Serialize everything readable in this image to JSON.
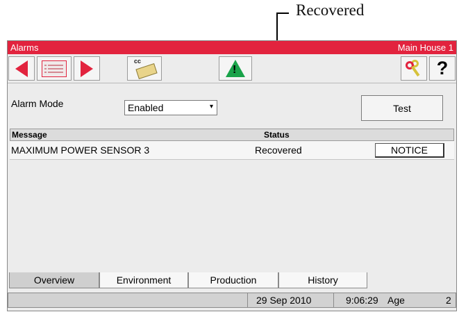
{
  "callout": {
    "label": "Recovered"
  },
  "window": {
    "title": "Alarms",
    "location": "Main House 1"
  },
  "toolbar": {
    "buttons": [
      {
        "name": "prev-arrow-icon"
      },
      {
        "name": "alarm-list-icon"
      },
      {
        "name": "next-arrow-icon"
      },
      {
        "name": "cc-copy-icon",
        "label": "cc"
      },
      {
        "name": "warning-icon",
        "label": "!"
      },
      {
        "name": "keys-icon"
      },
      {
        "name": "help-icon",
        "label": "?"
      }
    ],
    "colors": {
      "accent": "#e2233e",
      "warning": "#1aa34a"
    }
  },
  "alarm_mode": {
    "label": "Alarm Mode",
    "selected": "Enabled"
  },
  "test_button": {
    "label": "Test"
  },
  "table": {
    "headers": {
      "message": "Message",
      "status": "Status"
    },
    "rows": [
      {
        "message": "MAXIMUM POWER SENSOR  3",
        "status": "Recovered",
        "action": "NOTICE"
      }
    ]
  },
  "tabs": [
    {
      "label": "Overview",
      "active": true
    },
    {
      "label": "Environment",
      "active": false
    },
    {
      "label": "Production",
      "active": false
    },
    {
      "label": "History",
      "active": false
    }
  ],
  "status_bar": {
    "date": "29 Sep 2010",
    "time": "9:06:29",
    "age_label": "Age",
    "age_value": "2"
  }
}
